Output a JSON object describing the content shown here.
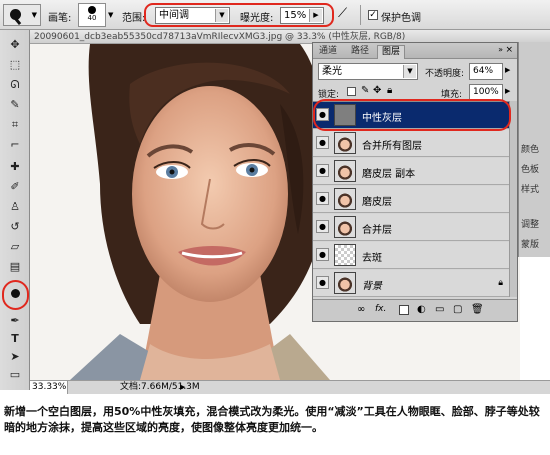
{
  "options_bar": {
    "brush_label": "画笔:",
    "brush_size": "40",
    "range_label": "范围:",
    "range_value": "中间调",
    "exposure_label": "曝光度:",
    "exposure_value": "15%",
    "protect_tones_label": "保护色调",
    "protect_tones_checked": true,
    "highlight_color": "#e0281e"
  },
  "document": {
    "title": "20090601_dcb3eab55350cd78713aVmRIlecvXMG3.jpg @ 33.3% (中性灰层, RGB/8)",
    "zoom": "33.33%",
    "doc_size": "文档:7.66M/51.3M"
  },
  "layers_panel": {
    "tabs": [
      "通道",
      "路径",
      "图层"
    ],
    "active_tab": "图层",
    "blend_mode": "柔光",
    "opacity_label": "不透明度:",
    "opacity_value": "64%",
    "lock_label": "锁定:",
    "fill_label": "填充:",
    "fill_value": "100%",
    "selection_color": "#0a2a6e",
    "layers": [
      {
        "name": "中性灰层",
        "thumb": "gray",
        "selected": true
      },
      {
        "name": "合并所有图层",
        "thumb": "face",
        "selected": false
      },
      {
        "name": "磨皮层 副本",
        "thumb": "face",
        "selected": false
      },
      {
        "name": "磨皮层",
        "thumb": "face",
        "selected": false
      },
      {
        "name": "合并层",
        "thumb": "face",
        "selected": false
      },
      {
        "name": "去斑",
        "thumb": "check",
        "selected": false
      },
      {
        "name": "背景",
        "thumb": "face",
        "selected": false,
        "locked": true
      }
    ],
    "footer_icons": [
      "link-icon",
      "fx-icon",
      "mask-icon",
      "adjustment-icon",
      "group-icon",
      "new-layer-icon",
      "trash-icon"
    ]
  },
  "dock": {
    "items": [
      "颜色",
      "色板",
      "样式",
      "调整",
      "蒙版"
    ]
  },
  "caption": {
    "text": "新增一个空白图层，用50%中性灰填充，混合模式改为柔光。使用“减淡”工具在人物眼眶、脸部、脖子等处较暗的地方涂抹，提高这些区域的亮度，使图像整体亮度更加统一。"
  }
}
